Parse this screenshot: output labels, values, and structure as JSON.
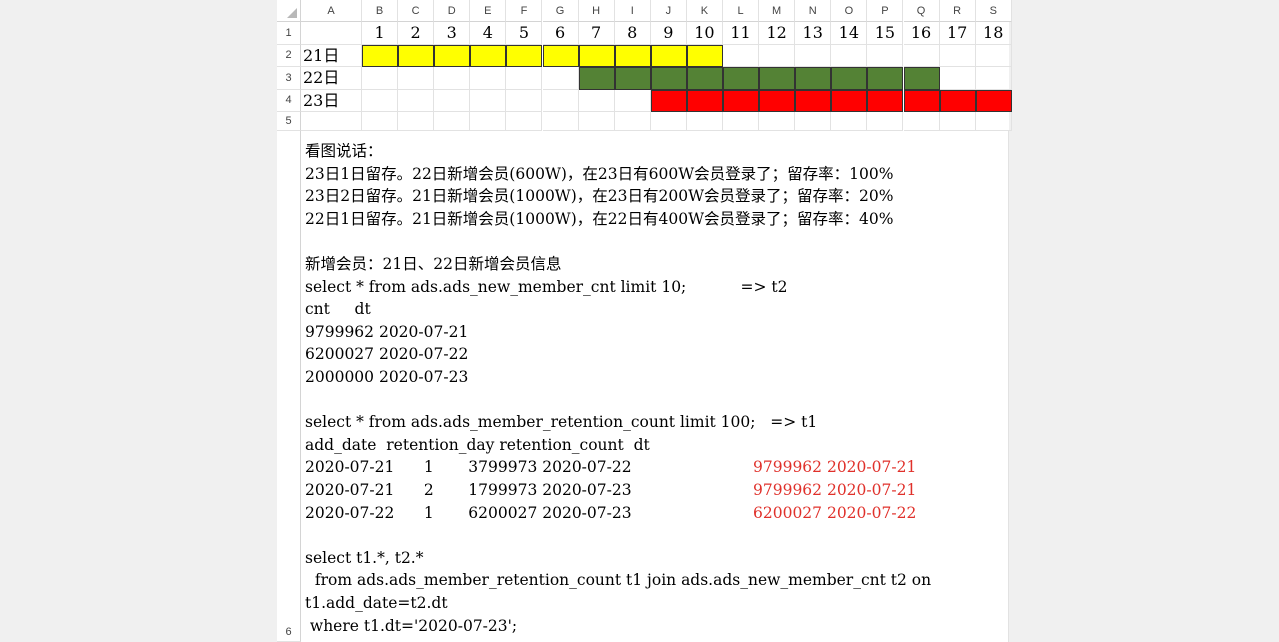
{
  "columns": [
    "A",
    "B",
    "C",
    "D",
    "E",
    "F",
    "G",
    "H",
    "I",
    "J",
    "K",
    "L",
    "M",
    "N",
    "O",
    "P",
    "Q",
    "R",
    "S"
  ],
  "rows": [
    "1",
    "2",
    "3",
    "4",
    "5",
    "6"
  ],
  "day_numbers": [
    "1",
    "2",
    "3",
    "4",
    "5",
    "6",
    "7",
    "8",
    "9",
    "10",
    "11",
    "12",
    "13",
    "14",
    "15",
    "16",
    "17",
    "18"
  ],
  "row_labels": [
    "21日",
    "22日",
    "23日"
  ],
  "bars": [
    {
      "label": "21日",
      "start": 1,
      "end": 10,
      "color": "#ffff00"
    },
    {
      "label": "22日",
      "start": 7,
      "end": 16,
      "color": "#548235"
    },
    {
      "label": "23日",
      "start": 9,
      "end": 18,
      "color": "#ff0000"
    }
  ],
  "text_lines": [
    "看图说话：",
    "23日1日留存。22日新增会员(600W)，在23日有600W会员登录了；留存率：100%",
    "23日2日留存。21日新增会员(1000W)，在23日有200W会员登录了；留存率：20%",
    "22日1日留存。21日新增会员(1000W)，在22日有400W会员登录了；留存率：40%",
    "",
    "新增会员：21日、22日新增会员信息",
    "select * from ads.ads_new_member_cnt limit 10;           => t2",
    "cnt     dt",
    "9799962 2020-07-21",
    "6200027 2020-07-22",
    "2000000 2020-07-23",
    "",
    "select * from ads.ads_member_retention_count limit 100;   => t1",
    "add_date  retention_day retention_count  dt",
    "2020-07-21      1       3799973 2020-07-22",
    "2020-07-21      2       1799973 2020-07-23",
    "2020-07-22      1       6200027 2020-07-23",
    "",
    "select t1.*, t2.*",
    "  from ads.ads_member_retention_count t1 join ads.ads_new_member_cnt t2 on",
    "t1.add_date=t2.dt",
    " where t1.dt='2020-07-23';"
  ],
  "red_annotations": [
    {
      "line": 14,
      "text": "9799962 2020-07-21"
    },
    {
      "line": 15,
      "text": "9799962 2020-07-21"
    },
    {
      "line": 16,
      "text": "6200027 2020-07-22"
    }
  ],
  "colors": {
    "accent_red": "#e0302a",
    "yellow": "#ffff00",
    "green": "#548235",
    "red": "#ff0000"
  }
}
